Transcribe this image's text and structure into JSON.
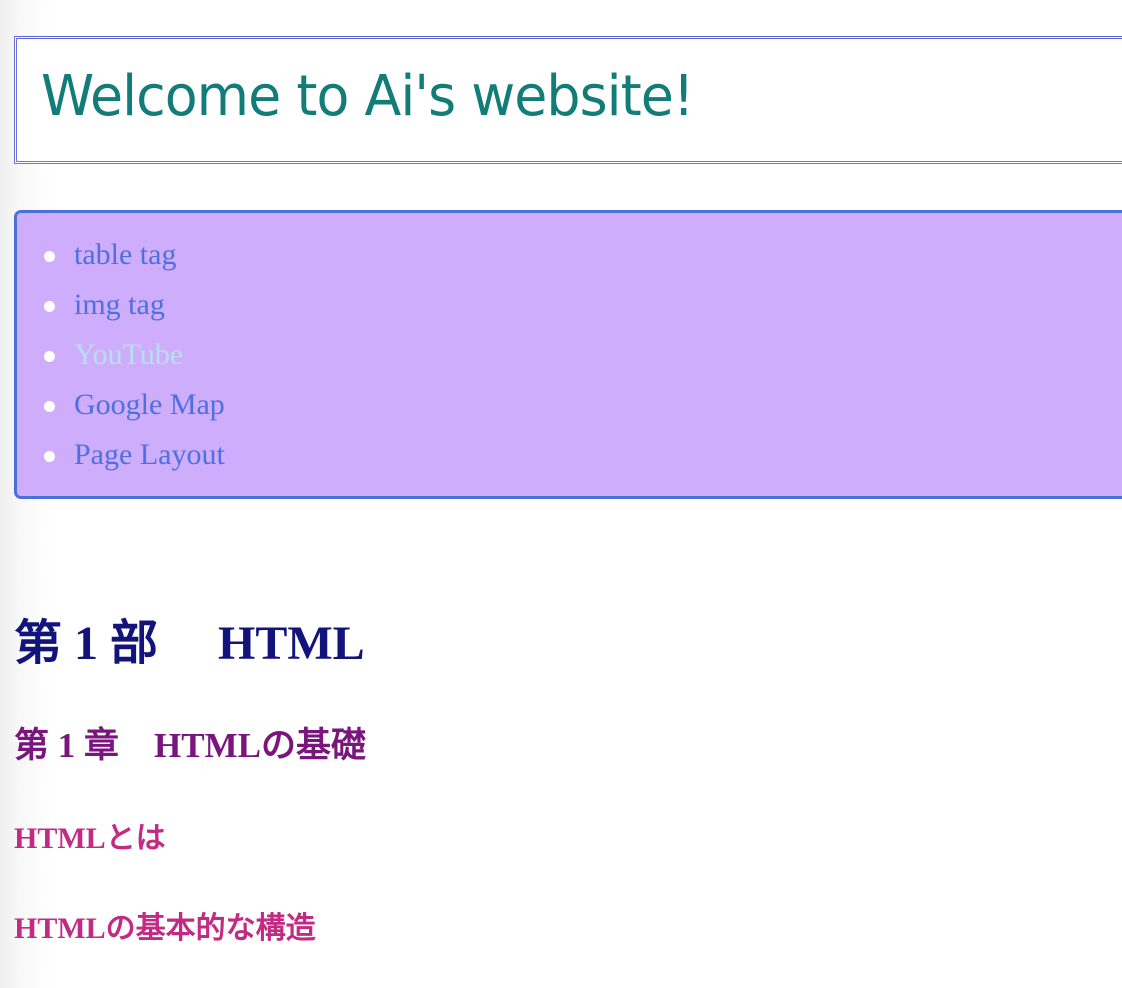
{
  "header": {
    "title": "Welcome to Ai's website!"
  },
  "nav": {
    "items": [
      {
        "label": "table tag",
        "visited": false
      },
      {
        "label": "img tag",
        "visited": false
      },
      {
        "label": "YouTube",
        "visited": true
      },
      {
        "label": "Google Map",
        "visited": false
      },
      {
        "label": "Page Layout",
        "visited": false
      }
    ]
  },
  "content": {
    "part_title": "第 1 部　 HTML",
    "chapter_title": "第 1 章　HTMLの基礎",
    "sections": [
      "HTMLとは",
      "HTMLの基本的な構造"
    ]
  },
  "colors": {
    "header_title": "#127d78",
    "nav_background": "#ceaefc",
    "nav_border": "#4a70dc",
    "nav_link": "#4f6ee0",
    "nav_link_visited": "#b7e0ec",
    "part_title": "#13137c",
    "chapter_title": "#7a157e",
    "section_title": "#c22b84"
  }
}
